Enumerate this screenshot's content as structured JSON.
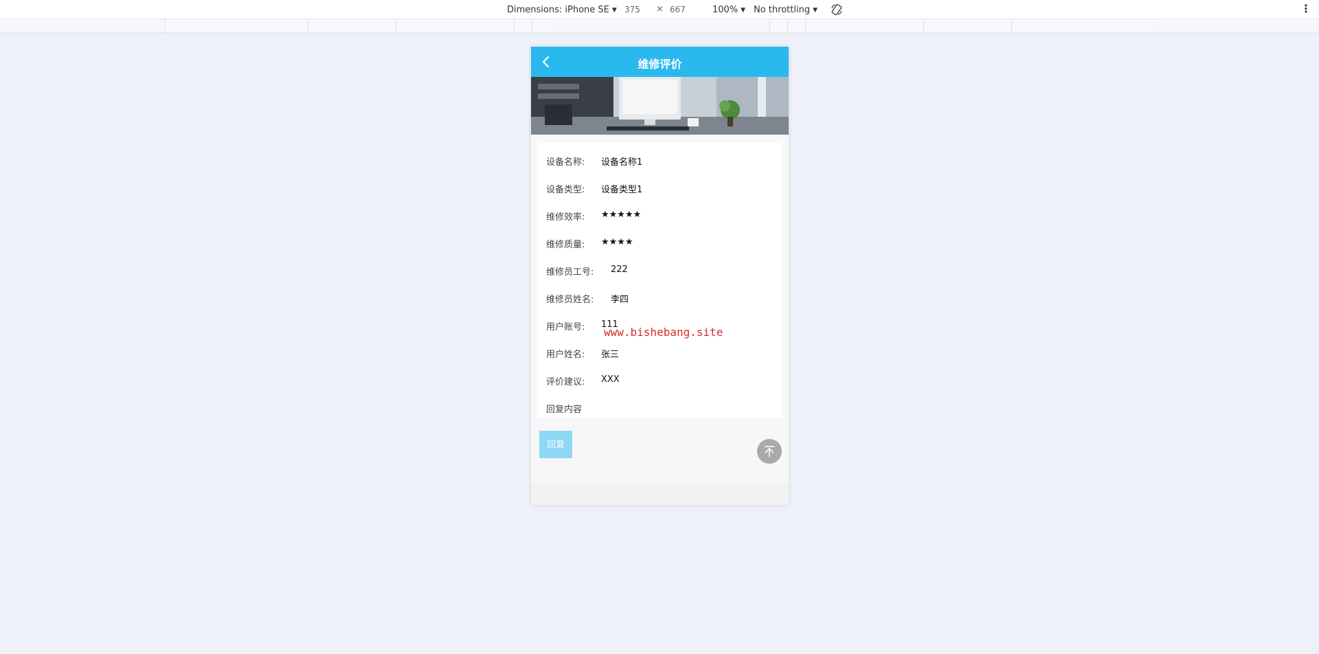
{
  "devtools": {
    "dimensions_label": "Dimensions: iPhone SE",
    "width": "375",
    "times": "×",
    "height": "667",
    "zoom": "100%",
    "throttling": "No throttling",
    "rotate_icon": "rotate-icon",
    "more_icon": "more-vertical-icon"
  },
  "page": {
    "title": "维修评价",
    "back_icon": "chevron-left-icon",
    "nav_color": "#29b9ee"
  },
  "details": [
    {
      "label": "设备名称:",
      "value": "设备名称1"
    },
    {
      "label": "设备类型:",
      "value": "设备类型1"
    },
    {
      "label": "维修效率:",
      "value": "★★★★★"
    },
    {
      "label": "维修质量:",
      "value": "★★★★"
    },
    {
      "label": "维修员工号:",
      "value": "222"
    },
    {
      "label": "维修员姓名:",
      "value": "李四"
    },
    {
      "label": "用户账号:",
      "value": "111"
    },
    {
      "label": "用户姓名:",
      "value": "张三"
    },
    {
      "label": "评价建议:",
      "value": "XXX"
    },
    {
      "label": "回复内容",
      "value": ""
    }
  ],
  "watermark": "www.bishebang.site",
  "reply_button": "回复",
  "back_to_top_icon": "arrow-up-to-top-icon"
}
